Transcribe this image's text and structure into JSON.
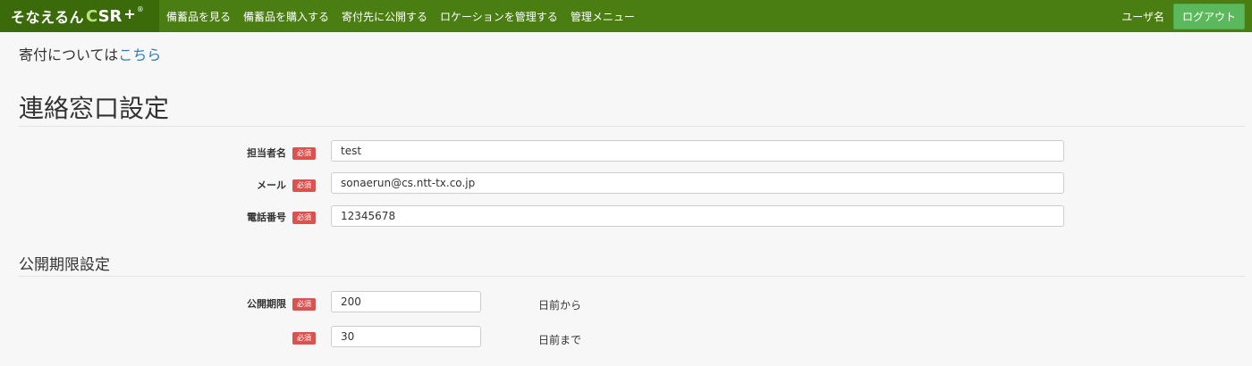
{
  "navbar": {
    "brand_text": "そなえるん",
    "brand_logo_c": "C",
    "brand_logo_rest": "SR",
    "brand_plus": "+",
    "brand_reg": "®",
    "items": [
      {
        "label": "備蓄品を見る"
      },
      {
        "label": "備蓄品を購入する"
      },
      {
        "label": "寄付先に公開する"
      },
      {
        "label": "ロケーションを管理する"
      },
      {
        "label": "管理メニュー"
      }
    ],
    "username": "ユーザ名",
    "logout": "ログアウト"
  },
  "donation": {
    "prefix": "寄付についてはこ",
    "prefix_text": "寄付については",
    "link": "こちら"
  },
  "page_title": "連絡窓口設定",
  "contact": {
    "name_label": "担当者名",
    "name_value": "test",
    "mail_label": "メール",
    "mail_value": "sonaerun@cs.ntt-tx.co.jp",
    "phone_label": "電話番号",
    "phone_value": "12345678",
    "required": "必須"
  },
  "period": {
    "section_title": "公開期限設定",
    "label": "公開期限",
    "from_value": "200",
    "from_suffix": "日前から",
    "to_value": "30",
    "to_suffix": "日前まで",
    "required": "必須"
  },
  "colors": {
    "navbar": "#4a7d12",
    "brand_bg": "#3a6a0a",
    "logout": "#5cb85c",
    "required_badge": "#d9534f",
    "link": "#337ab7"
  }
}
